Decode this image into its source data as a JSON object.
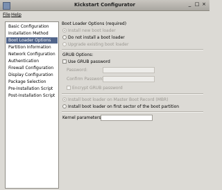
{
  "window": {
    "title": "Kickstart Configurator",
    "buttons": [
      "_",
      "□",
      "×"
    ]
  },
  "menubar": {
    "file": "File",
    "help": "Help"
  },
  "sidebar": {
    "items": [
      {
        "label": "Basic Configuration"
      },
      {
        "label": "Installation Method"
      },
      {
        "label": "Boot Loader Options",
        "selected": true
      },
      {
        "label": "Partition Information"
      },
      {
        "label": "Network Configuration"
      },
      {
        "label": "Authentication"
      },
      {
        "label": "Firewall Configuration"
      },
      {
        "label": "Display Configuration"
      },
      {
        "label": "Package Selection"
      },
      {
        "label": "Pre-Installation Script"
      },
      {
        "label": "Post-Installation Script"
      }
    ]
  },
  "boot": {
    "heading": "Boot Loader Options (required)",
    "install_new": "Install new boot loader",
    "do_not_install": "Do not install a boot loader",
    "upgrade_existing": "Upgrade existing boot loader",
    "grub_options": "GRUB Options:",
    "use_grub_password": "Use GRUB password",
    "password_label": "Password:",
    "password_value": "",
    "confirm_password_label": "Confirm Password:",
    "confirm_password_value": "",
    "encrypt_grub": "Encrypt GRUB password",
    "mbr": "Install boot loader on Master Boot Record (MBR)",
    "first_sector": "Install boot loader on first sector of the boot partition",
    "kernel_label": "Kernel parameters:",
    "kernel_value": ""
  },
  "colors": {
    "selection": "#51658b",
    "window_bg": "#dcdad5"
  }
}
